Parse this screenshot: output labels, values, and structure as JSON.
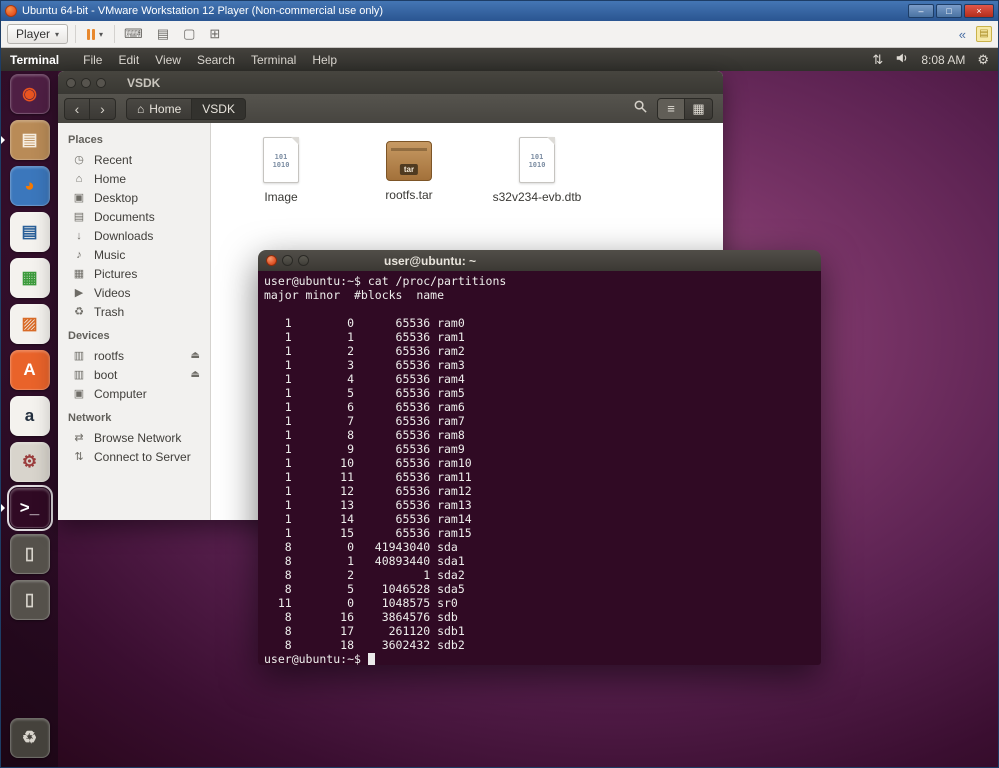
{
  "colors": {
    "ubuntu_orange": "#e95420",
    "terminal_bg": "#300a24",
    "titlebar_blue": "#2a5591",
    "menubar_dark": "#31302c"
  },
  "vmware": {
    "title": "Ubuntu 64-bit - VMware Workstation 12 Player (Non-commercial use only)",
    "player_label": "Player",
    "caret": "▾",
    "caption": {
      "minimize": "–",
      "maximize": "□",
      "close": "×"
    },
    "toolbar_icons": [
      {
        "name": "send-ctrl-alt-del-icon",
        "glyph": "⌨"
      },
      {
        "name": "devices-icon",
        "glyph": "▤"
      },
      {
        "name": "enter-fullscreen-icon",
        "glyph": "▢"
      },
      {
        "name": "unity-mode-icon",
        "glyph": "⊞"
      }
    ],
    "collapse_glyph": "«"
  },
  "menubar": {
    "app_name": "Terminal",
    "menus": [
      "File",
      "Edit",
      "View",
      "Search",
      "Terminal",
      "Help"
    ],
    "network_glyph": "⇅",
    "clock": "8:08 AM",
    "session_glyph": "⚙"
  },
  "launcher": {
    "items": [
      {
        "name": "dash-home",
        "glyph": "◉",
        "bg": "#4f1f44",
        "fg": "#e95420",
        "running": false,
        "focused": false
      },
      {
        "name": "files",
        "glyph": "▤",
        "bg": "#b98b57",
        "fg": "#f7efe2",
        "running": true,
        "focused": false
      },
      {
        "name": "firefox",
        "glyph": "◕",
        "bg": "#3b77bc",
        "fg": "#f57900",
        "running": false,
        "focused": false
      },
      {
        "name": "libreoffice-writer",
        "glyph": "▤",
        "bg": "#f4f2ee",
        "fg": "#2a6099",
        "running": false,
        "focused": false
      },
      {
        "name": "libreoffice-calc",
        "glyph": "▦",
        "bg": "#f4f2ee",
        "fg": "#3c9b3c",
        "running": false,
        "focused": false
      },
      {
        "name": "libreoffice-impress",
        "glyph": "▨",
        "bg": "#f4f2ee",
        "fg": "#d96b27",
        "running": false,
        "focused": false
      },
      {
        "name": "ubuntu-software-center",
        "glyph": "A",
        "bg": "#e9632a",
        "fg": "#ffffff",
        "running": false,
        "focused": false
      },
      {
        "name": "amazon",
        "glyph": "a",
        "bg": "#f4f2ee",
        "fg": "#232f3e",
        "running": false,
        "focused": false
      },
      {
        "name": "system-settings",
        "glyph": "⚙",
        "bg": "#d8d4cc",
        "fg": "#9a3b3b",
        "running": false,
        "focused": false
      },
      {
        "name": "terminal",
        "glyph": ">_",
        "bg": "#300a24",
        "fg": "#ffffff",
        "running": true,
        "focused": true
      },
      {
        "name": "usb-drive-1",
        "glyph": "▯",
        "bg": "#55514b",
        "fg": "#d8d4cc",
        "running": false,
        "focused": false
      },
      {
        "name": "usb-drive-2",
        "glyph": "▯",
        "bg": "#55514b",
        "fg": "#d8d4cc",
        "running": false,
        "focused": false
      }
    ],
    "trash": {
      "glyph": "♻",
      "bg": "#45423c",
      "fg": "#d8d4cc"
    }
  },
  "file_manager": {
    "title": "VSDK",
    "back_glyph": "‹",
    "forward_glyph": "›",
    "home_crumb": {
      "icon": "⌂",
      "label": "Home"
    },
    "path_crumb": "VSDK",
    "list_view_glyph": "≡",
    "grid_view_glyph": "▦",
    "sidebar": {
      "places_header": "Places",
      "places": [
        {
          "icon": "◷",
          "label": "Recent"
        },
        {
          "icon": "⌂",
          "label": "Home"
        },
        {
          "icon": "▣",
          "label": "Desktop"
        },
        {
          "icon": "▤",
          "label": "Documents"
        },
        {
          "icon": "↓",
          "label": "Downloads"
        },
        {
          "icon": "♪",
          "label": "Music"
        },
        {
          "icon": "▦",
          "label": "Pictures"
        },
        {
          "icon": "▶",
          "label": "Videos"
        },
        {
          "icon": "♻",
          "label": "Trash"
        }
      ],
      "devices_header": "Devices",
      "devices": [
        {
          "icon": "▥",
          "label": "rootfs",
          "eject": "⏏"
        },
        {
          "icon": "▥",
          "label": "boot",
          "eject": "⏏"
        },
        {
          "icon": "▣",
          "label": "Computer"
        }
      ],
      "network_header": "Network",
      "network": [
        {
          "icon": "⇄",
          "label": "Browse Network"
        },
        {
          "icon": "⇅",
          "label": "Connect to Server"
        }
      ]
    },
    "files": [
      {
        "label": "Image",
        "kind": "binary",
        "icon_text": "101\n1010"
      },
      {
        "label": "rootfs.tar",
        "kind": "tar",
        "icon_text": "tar"
      },
      {
        "label": "s32v234-evb.dtb",
        "kind": "binary",
        "icon_text": "101\n1010"
      }
    ]
  },
  "terminal": {
    "title": "user@ubuntu: ~",
    "lines": [
      "user@ubuntu:~$ cat /proc/partitions",
      "major minor  #blocks  name",
      "",
      "   1        0      65536 ram0",
      "   1        1      65536 ram1",
      "   1        2      65536 ram2",
      "   1        3      65536 ram3",
      "   1        4      65536 ram4",
      "   1        5      65536 ram5",
      "   1        6      65536 ram6",
      "   1        7      65536 ram7",
      "   1        8      65536 ram8",
      "   1        9      65536 ram9",
      "   1       10      65536 ram10",
      "   1       11      65536 ram11",
      "   1       12      65536 ram12",
      "   1       13      65536 ram13",
      "   1       14      65536 ram14",
      "   1       15      65536 ram15",
      "   8        0   41943040 sda",
      "   8        1   40893440 sda1",
      "   8        2          1 sda2",
      "   8        5    1046528 sda5",
      "  11        0    1048575 sr0",
      "   8       16    3864576 sdb",
      "   8       17     261120 sdb1",
      "   8       18    3602432 sdb2"
    ],
    "prompt": "user@ubuntu:~$ "
  }
}
